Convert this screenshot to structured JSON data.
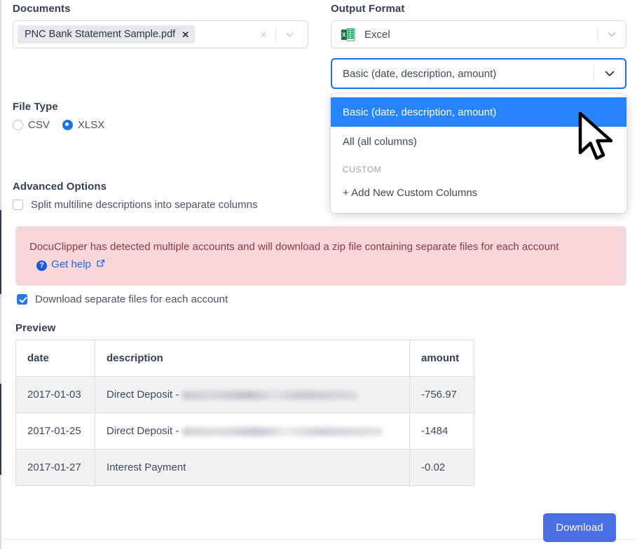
{
  "documents": {
    "label": "Documents",
    "chip": {
      "filename": "PNC Bank Statement Sample.pdf",
      "remove_label": "✕"
    },
    "clear_label": "×"
  },
  "file_type": {
    "label": "File Type",
    "options": [
      {
        "label": "CSV",
        "selected": false
      },
      {
        "label": "XLSX",
        "selected": true
      }
    ]
  },
  "advanced_options": {
    "label": "Advanced Options",
    "split_multiline": {
      "label": "Split multiline descriptions into separate columns",
      "checked": false
    }
  },
  "warning": {
    "text_before": "DocuClipper has detected multiple accounts and will download a zip file containing separate files for each account",
    "help_badge": "?",
    "help_link": "Get help",
    "bg_color": "#f8d7da",
    "text_color": "#8a3a43",
    "link_color": "#2563eb"
  },
  "separate_files": {
    "label": "Download separate files for each account",
    "checked": true
  },
  "preview": {
    "label": "Preview",
    "columns": [
      "date",
      "description",
      "amount"
    ],
    "rows": [
      {
        "date": "2017-01-03",
        "description": "Direct Deposit -",
        "redacted": true,
        "amount": "-756.97"
      },
      {
        "date": "2017-01-25",
        "description": "Direct Deposit -",
        "redacted": true,
        "amount": "-1484"
      },
      {
        "date": "2017-01-27",
        "description": "Interest Payment",
        "redacted": false,
        "amount": "-0.02"
      }
    ]
  },
  "output_format": {
    "label": "Output Format",
    "format_value": "Excel",
    "format_icon": "excel-icon",
    "columns_value": "Basic (date, description, amount)",
    "dropdown_open": true,
    "dropdown": {
      "items": [
        {
          "label": "Basic (date, description, amount)",
          "selected": true
        },
        {
          "label": "All (all columns)",
          "selected": false
        }
      ],
      "group_label": "CUSTOM",
      "add_custom_label": "+ Add New Custom Columns"
    },
    "accent_color": "#2684ff"
  },
  "footer": {
    "download_label": "Download",
    "download_color": "#4a6fe3"
  }
}
